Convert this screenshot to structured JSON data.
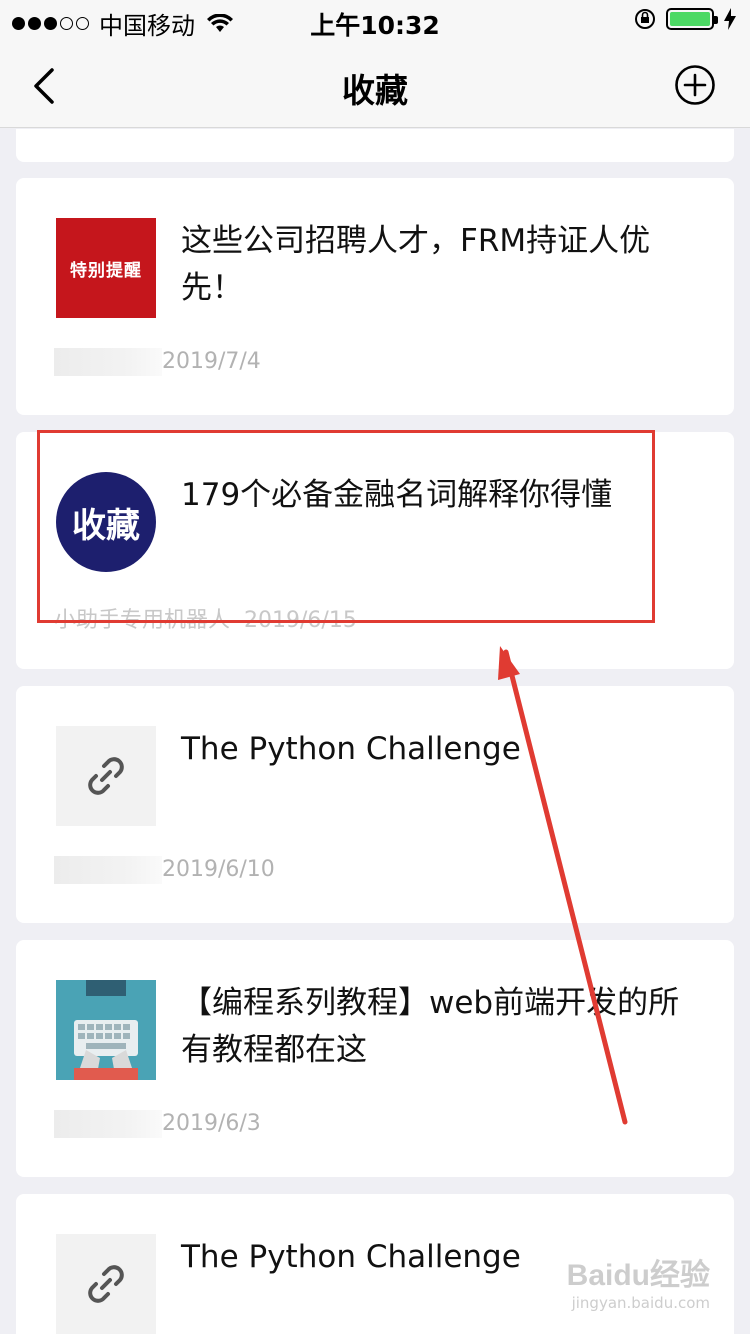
{
  "status_bar": {
    "carrier": "中国移动",
    "time": "上午10:32"
  },
  "nav": {
    "title": "收藏",
    "back_icon": "chevron-left-icon",
    "add_icon": "plus-circle-icon"
  },
  "items": [
    {
      "thumb_text": "特别提醒",
      "title": "这些公司招聘人才，FRM持证人优先！",
      "date": "2019/7/4"
    },
    {
      "thumb_text": "收藏",
      "title": "179个必备金融名词解释你得懂",
      "source": "小助手专用机器人",
      "date": "2019/6/15"
    },
    {
      "thumb_icon": "link-icon",
      "title": "The Python Challenge",
      "date": "2019/6/10"
    },
    {
      "thumb_icon": "keyboard-illustration",
      "title": "【编程系列教程】web前端开发的所有教程都在这",
      "date": "2019/6/3"
    },
    {
      "thumb_icon": "link-icon",
      "title": "The Python Challenge"
    }
  ],
  "watermark": {
    "main": "Baidu经验",
    "sub": "jingyan.baidu.com"
  },
  "colors": {
    "highlight": "#e03b32",
    "background": "#efeff4"
  }
}
